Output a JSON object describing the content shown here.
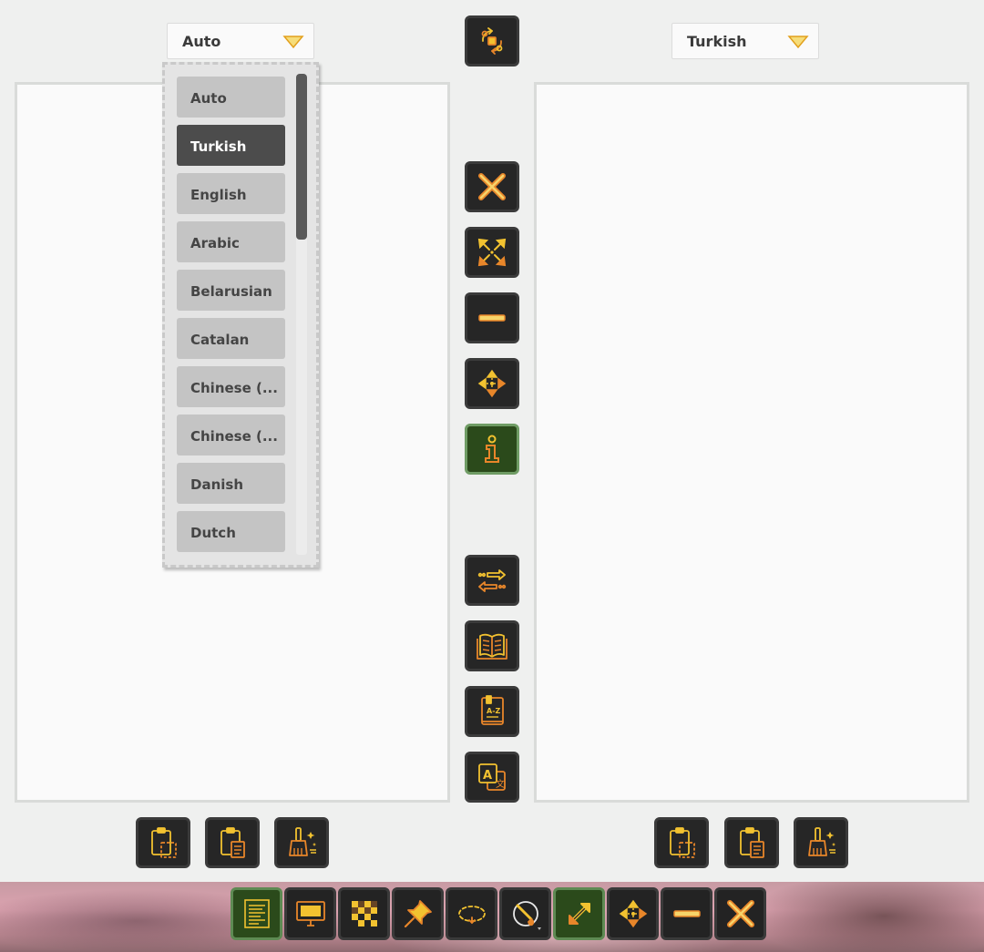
{
  "source_language": {
    "selected": "Auto"
  },
  "target_language": {
    "selected": "Turkish"
  },
  "dropdown": {
    "options": [
      "Auto",
      "Turkish",
      "English",
      "Arabic",
      "Belarusian",
      "Catalan",
      "Chinese (...",
      "Chinese (...",
      "Danish",
      "Dutch"
    ],
    "selected_index": 1
  },
  "colors": {
    "icon_yellow": "#f2c230",
    "icon_orange": "#e8862a",
    "button_dark": "#262626",
    "button_active_green": "#2b4a1b",
    "selected_option": "#4c4c4c",
    "panel_bg": "#fafafa"
  },
  "icons": {
    "swap_languages": "swap-languages-icon",
    "close": "close-icon",
    "expand": "expand-icon",
    "minimize": "minimize-icon",
    "move": "move-icon",
    "info": "info-icon",
    "translate_direction": "translate-direction-icon",
    "open_book": "open-book-icon",
    "dictionary": "dictionary-az-icon",
    "translate": "translate-icon",
    "copy": "copy-icon",
    "paste": "paste-icon",
    "clear": "clear-brush-icon"
  },
  "taskbar": {
    "items": [
      "text-panel-icon",
      "screen-monitor-icon",
      "checkerboard-icon",
      "pin-icon",
      "lasso-icon",
      "paint-brush-icon",
      "resize-diagonal-icon",
      "move-icon",
      "minimize-icon",
      "close-icon"
    ],
    "active": [
      "text-panel-icon",
      "resize-diagonal-icon"
    ]
  }
}
